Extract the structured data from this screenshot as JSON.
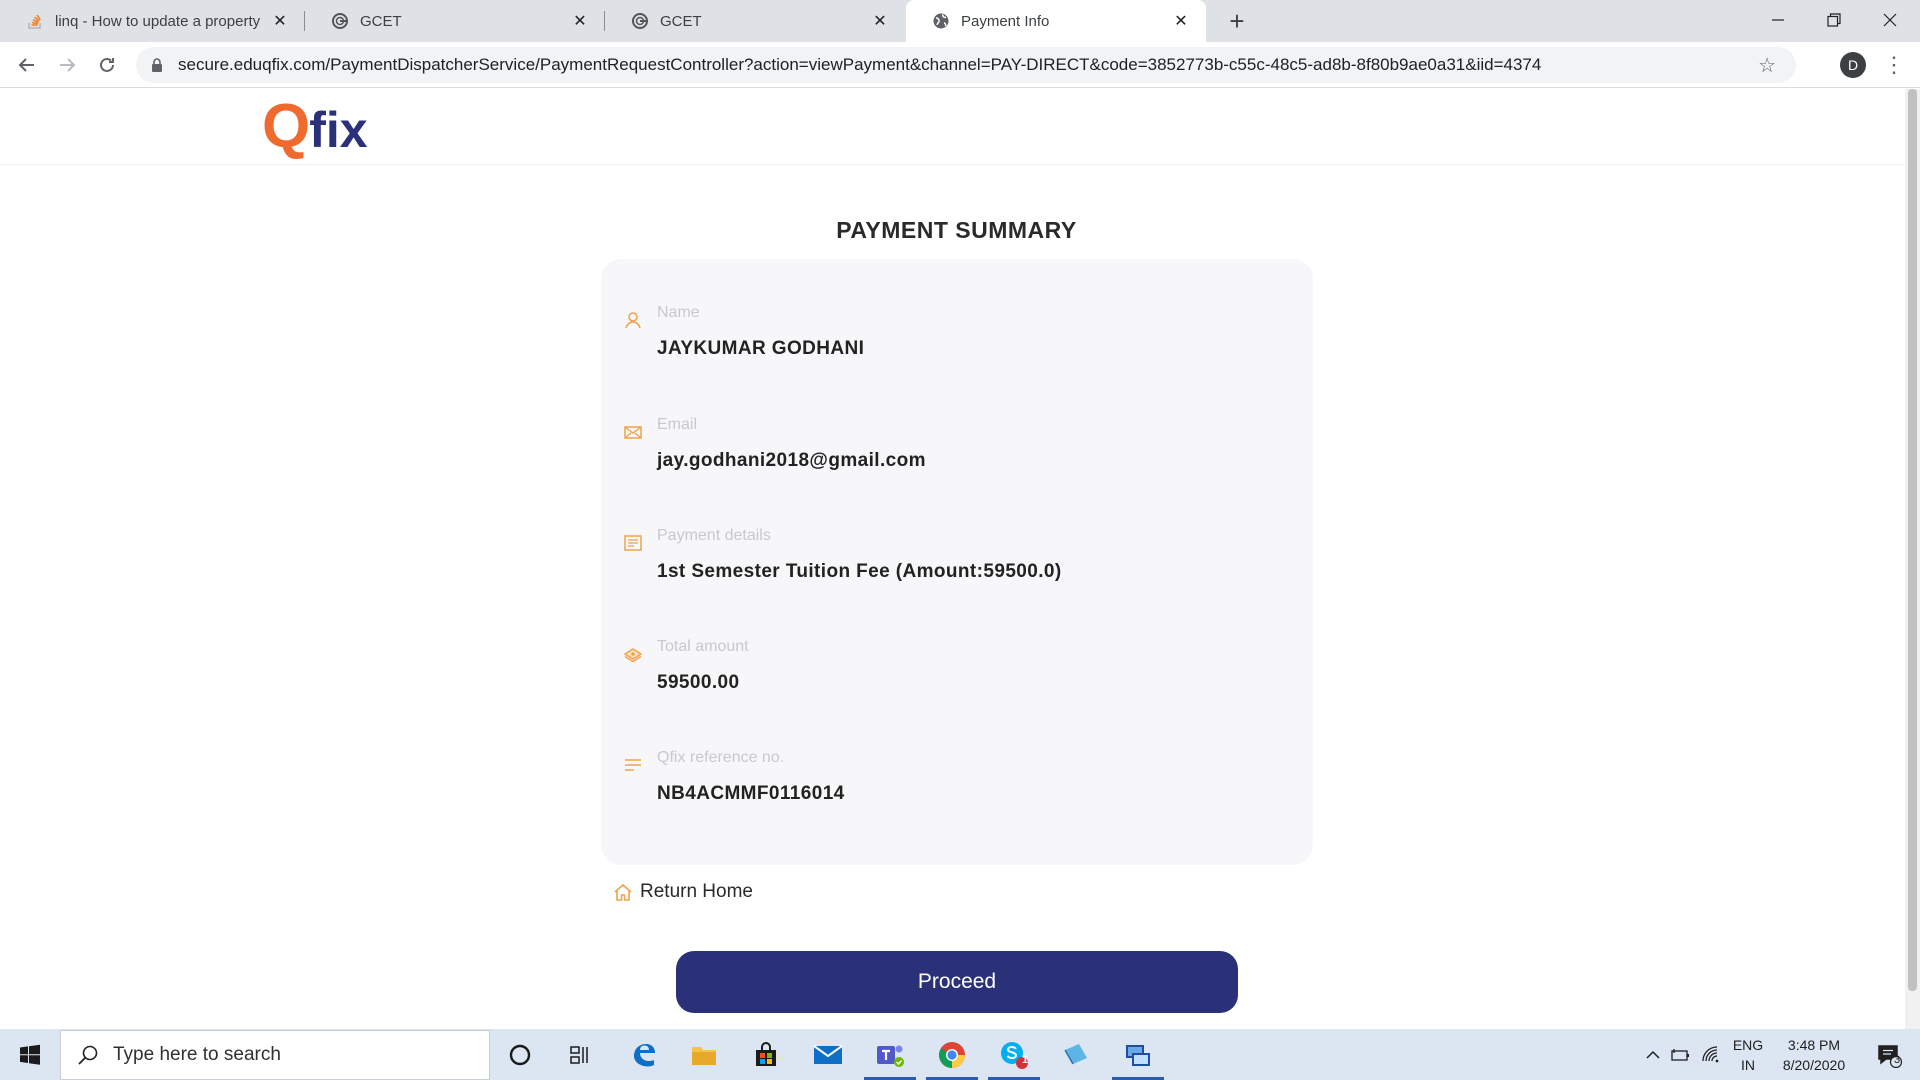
{
  "browser": {
    "tabs": [
      {
        "title": "linq - How to update a property",
        "icon": "stackoverflow-icon",
        "active": false
      },
      {
        "title": "GCET",
        "icon": "gcet-icon",
        "active": false
      },
      {
        "title": "GCET",
        "icon": "gcet-icon",
        "active": false
      },
      {
        "title": "Payment Info",
        "icon": "globe-icon",
        "active": true
      }
    ],
    "url": "secure.eduqfix.com/PaymentDispatcherService/PaymentRequestController?action=viewPayment&channel=PAY-DIRECT&code=3852773b-c55c-48c5-ad8b-8f80b9ae0a31&iid=4374",
    "profile_initial": "D"
  },
  "header": {
    "logo_q": "Q",
    "logo_rest": "fix"
  },
  "summary": {
    "title": "PAYMENT SUMMARY",
    "fields": [
      {
        "label": "Name",
        "value": "JAYKUMAR GODHANI",
        "icon": "user-icon"
      },
      {
        "label": "Email",
        "value": "jay.godhani2018@gmail.com",
        "icon": "envelope-icon"
      },
      {
        "label": "Payment details",
        "value": "1st Semester Tuition Fee (Amount:59500.0)",
        "icon": "document-icon"
      },
      {
        "label": "Total amount",
        "value": "59500.00",
        "icon": "cash-icon"
      },
      {
        "label": "Qfix reference no.",
        "value": "NB4ACMMF0116014",
        "icon": "lines-icon"
      }
    ],
    "return_home": "Return Home",
    "proceed": "Proceed"
  },
  "colors": {
    "brand_orange": "#ee6a2e",
    "brand_navy": "#2b3178"
  },
  "taskbar": {
    "search_placeholder": "Type here to search",
    "apps": [
      "cortana-icon",
      "task-view-icon",
      "edge-icon",
      "file-explorer-icon",
      "store-icon",
      "mail-icon",
      "teams-icon",
      "chrome-icon",
      "skype-icon",
      "notepad-icon",
      "remote-desktop-icon"
    ],
    "skype_badge": "1",
    "lang_line1": "ENG",
    "lang_line2": "IN",
    "time": "3:48 PM",
    "date": "8/20/2020",
    "notification_count": "3"
  }
}
